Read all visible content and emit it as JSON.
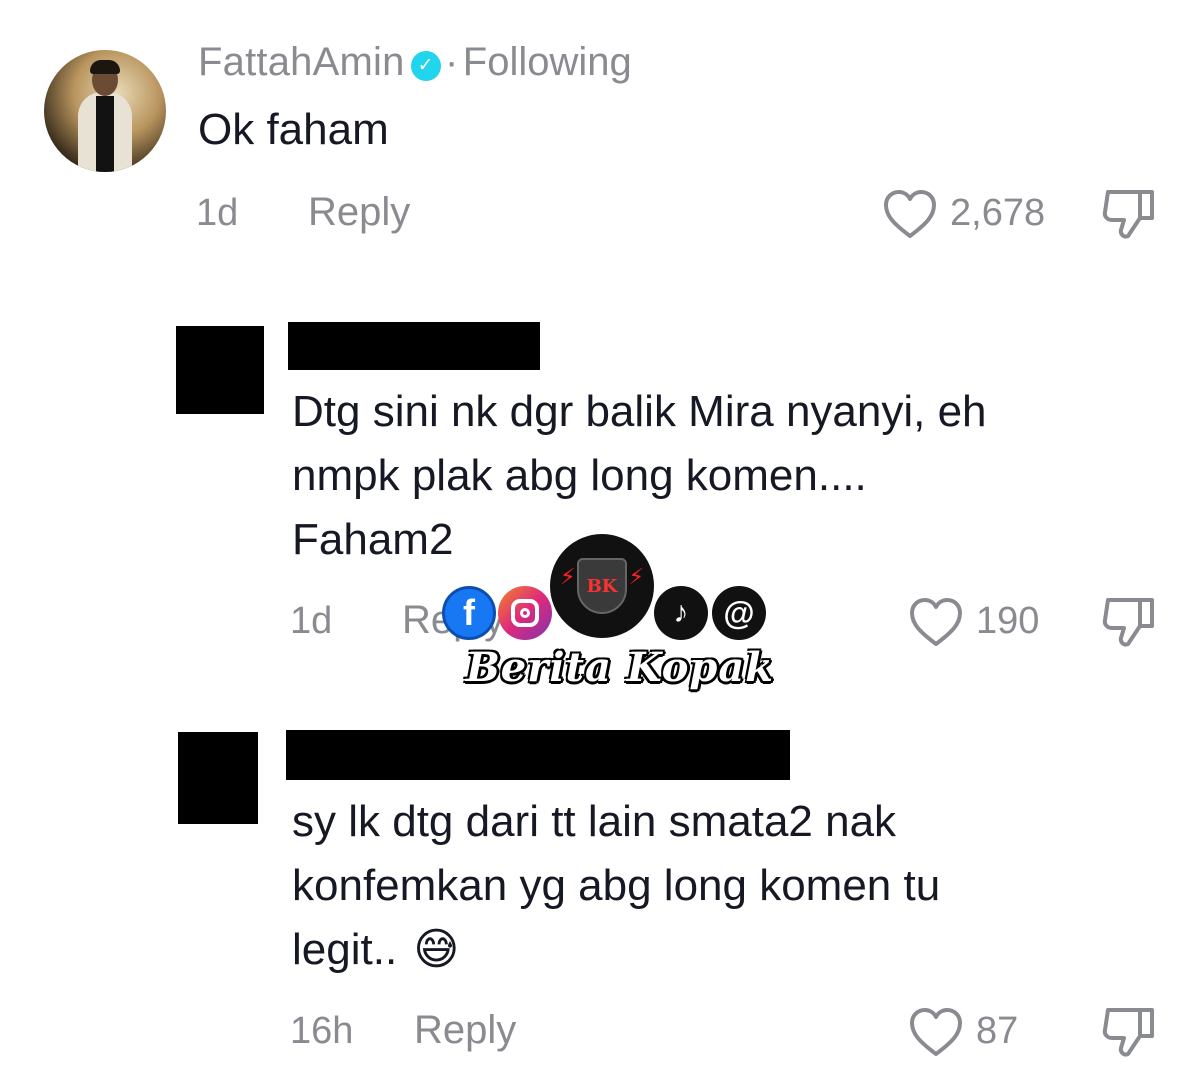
{
  "comments": [
    {
      "username": "FattahAmin",
      "separator": "·",
      "following": "Following",
      "text": "Ok faham",
      "time": "1d",
      "reply_label": "Reply",
      "likes": "2,678"
    },
    {
      "text_lines": [
        "Dtg sini nk dgr balik Mira nyanyi, eh",
        "nmpk plak abg long komen....",
        "Faham2"
      ],
      "time": "1d",
      "reply_label": "Reply",
      "likes": "190"
    },
    {
      "text_lines": [
        "sy lk dtg dari tt lain smata2 nak",
        "konfemkan yg abg long komen tu",
        "legit.."
      ],
      "emoji": "😅",
      "time": "16h",
      "reply_label": "Reply",
      "likes": "87"
    }
  ],
  "watermark": {
    "title": "Berita Kopak",
    "badge": "BK",
    "icons": [
      "facebook-icon",
      "instagram-icon",
      "bk-logo-icon",
      "tiktok-icon",
      "threads-icon"
    ],
    "colors": {
      "facebook": "#1877f2",
      "instagram": "#e1306c",
      "dark": "#111111"
    }
  },
  "colors": {
    "text": "#161823",
    "muted": "#8a8b91",
    "verified": "#20d5ec"
  }
}
